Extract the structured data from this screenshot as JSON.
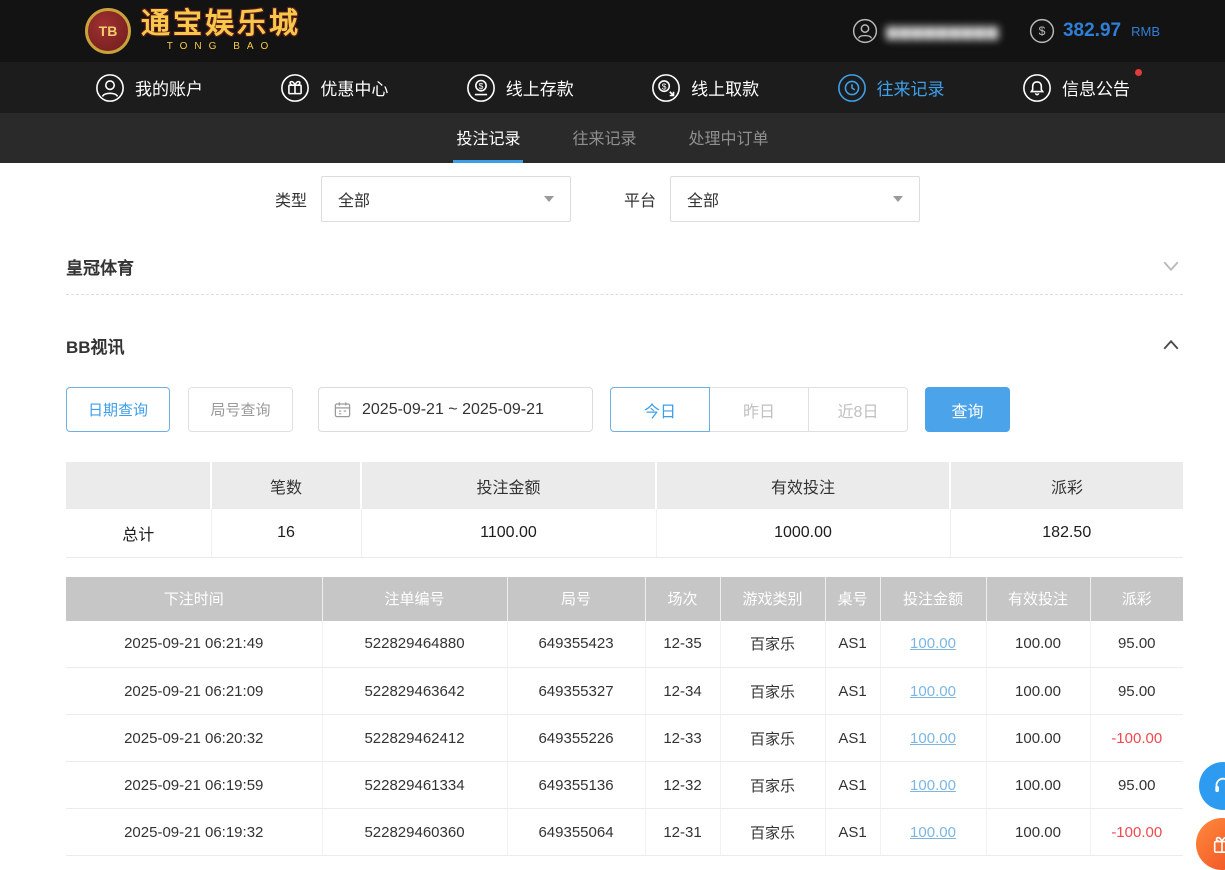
{
  "header": {
    "logo_badge": "TB",
    "logo_title": "通宝娱乐城",
    "logo_subtitle": "TONG BAO",
    "username_masked": "▆▆▆▆▆▆▆▆▆",
    "balance": "382.97",
    "currency": "RMB"
  },
  "nav": {
    "items": [
      {
        "label": "我的账户"
      },
      {
        "label": "优惠中心"
      },
      {
        "label": "线上存款"
      },
      {
        "label": "线上取款"
      },
      {
        "label": "往来记录"
      },
      {
        "label": "信息公告"
      }
    ]
  },
  "tabs": {
    "items": [
      {
        "label": "投注记录"
      },
      {
        "label": "往来记录"
      },
      {
        "label": "处理中订单"
      }
    ]
  },
  "filters": {
    "type_label": "类型",
    "type_value": "全部",
    "platform_label": "平台",
    "platform_value": "全部"
  },
  "sections": {
    "crown_title": "皇冠体育",
    "bb_title": "BB视讯"
  },
  "query": {
    "date_query": "日期查询",
    "round_query": "局号查询",
    "date_range": "2025-09-21 ~ 2025-09-21",
    "today": "今日",
    "yesterday": "昨日",
    "last8": "近8日",
    "search": "查询"
  },
  "summary": {
    "headers": [
      "笔数",
      "投注金额",
      "有效投注",
      "派彩"
    ],
    "row_label": "总计",
    "count": "16",
    "bet_amount": "1100.00",
    "valid_bet": "1000.00",
    "payout": "182.50"
  },
  "table": {
    "headers": [
      "下注时间",
      "注单编号",
      "局号",
      "场次",
      "游戏类别",
      "桌号",
      "投注金额",
      "有效投注",
      "派彩"
    ],
    "rows": [
      {
        "time": "2025-09-21 06:21:49",
        "bet_id": "522829464880",
        "round_id": "649355423",
        "session": "12-35",
        "game": "百家乐",
        "table_no": "AS1",
        "amount": "100.00",
        "valid": "100.00",
        "payout": "95.00"
      },
      {
        "time": "2025-09-21 06:21:09",
        "bet_id": "522829463642",
        "round_id": "649355327",
        "session": "12-34",
        "game": "百家乐",
        "table_no": "AS1",
        "amount": "100.00",
        "valid": "100.00",
        "payout": "95.00"
      },
      {
        "time": "2025-09-21 06:20:32",
        "bet_id": "522829462412",
        "round_id": "649355226",
        "session": "12-33",
        "game": "百家乐",
        "table_no": "AS1",
        "amount": "100.00",
        "valid": "100.00",
        "payout": "-100.00"
      },
      {
        "time": "2025-09-21 06:19:59",
        "bet_id": "522829461334",
        "round_id": "649355136",
        "session": "12-32",
        "game": "百家乐",
        "table_no": "AS1",
        "amount": "100.00",
        "valid": "100.00",
        "payout": "95.00"
      },
      {
        "time": "2025-09-21 06:19:32",
        "bet_id": "522829460360",
        "round_id": "649355064",
        "session": "12-31",
        "game": "百家乐",
        "table_no": "AS1",
        "amount": "100.00",
        "valid": "100.00",
        "payout": "-100.00"
      }
    ]
  },
  "colors": {
    "accent_blue": "#3e9fe9",
    "link_blue": "#7db6e3",
    "negative_red": "#f0484d"
  }
}
